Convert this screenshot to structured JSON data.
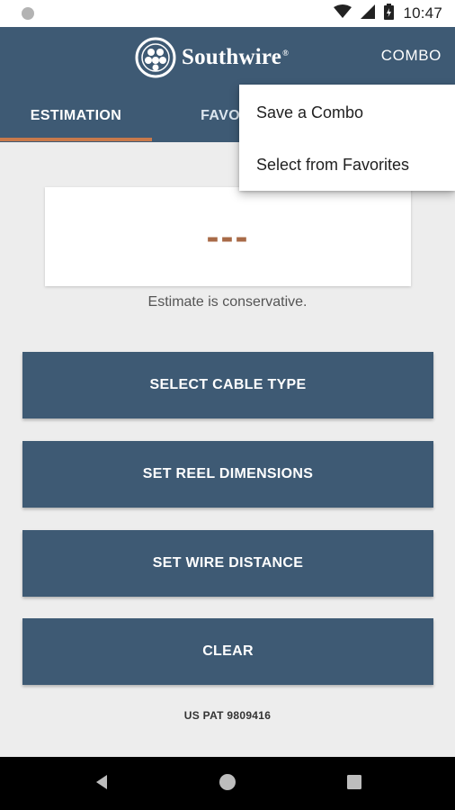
{
  "status_bar": {
    "time": "10:47",
    "icons": [
      "notification-dot-icon",
      "wifi-icon",
      "signal-icon",
      "battery-icon"
    ]
  },
  "app_bar": {
    "logo_text": "Southwire",
    "logo_mark": "®",
    "combo_label": "COMBO",
    "background": "#3e5a74"
  },
  "tabs": [
    {
      "label": "ESTIMATION",
      "selected": true
    },
    {
      "label": "FAVORI",
      "selected": false
    }
  ],
  "tab_indicator_color": "#c8794b",
  "result": {
    "value": "---",
    "note": "Estimate is conservative.",
    "value_color": "#a86a47"
  },
  "buttons": {
    "select_cable": "SELECT CABLE TYPE",
    "set_reel": "SET REEL DIMENSIONS",
    "set_wire": "SET WIRE DISTANCE",
    "clear": "CLEAR"
  },
  "patent": "US PAT 9809416",
  "overflow_menu": {
    "items": [
      "Save a Combo",
      "Select from Favorites"
    ]
  },
  "nav_bar": {
    "icons": [
      "back-icon",
      "home-icon",
      "recents-icon"
    ]
  }
}
